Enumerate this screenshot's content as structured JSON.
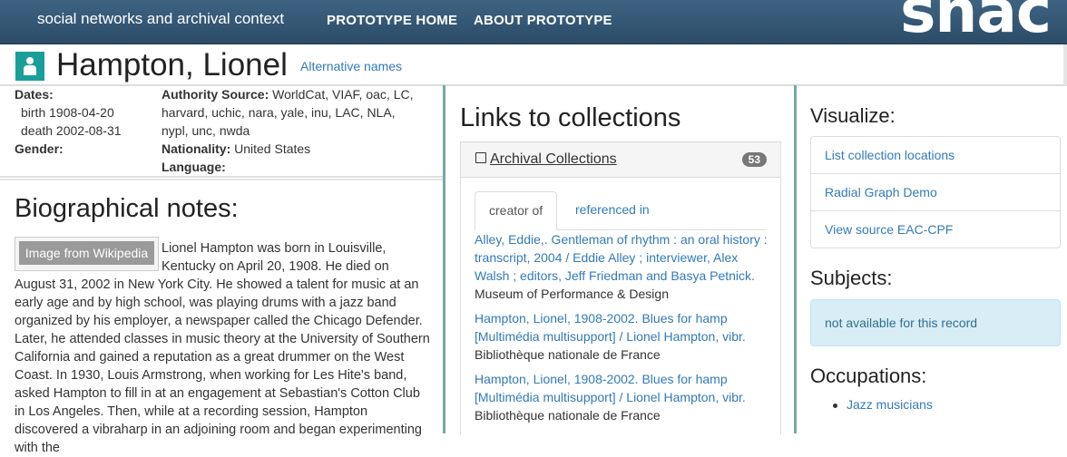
{
  "nav": {
    "brand": "social networks and archival context",
    "links": [
      "PROTOTYPE HOME",
      "ABOUT PROTOTYPE"
    ],
    "logo": "snac"
  },
  "header": {
    "name": "Hampton, Lionel",
    "alt_names_link": "Alternative names"
  },
  "meta": {
    "dates_label": "Dates:",
    "birth": "birth 1908-04-20",
    "death": "death 2002-08-31",
    "gender_label": "Gender:",
    "authority_label": "Authority Source:",
    "authority_line1": "WorldCat, VIAF, oac, LC,",
    "authority_line2": "harvard, uchic, nara, yale, inu, LAC, NLA,",
    "authority_line3": "nypl, unc, nwda",
    "nationality_label": "Nationality:",
    "nationality": "United States",
    "language_label": "Language:"
  },
  "bio": {
    "heading": "Biographical notes:",
    "image_label": "Image from Wikipedia",
    "text": "Lionel Hampton was born in Louisville, Kentucky on April 20, 1908. He died on August 31, 2002 in New York City. He showed a talent for music at an early age and by high school, was playing drums with a jazz band organized by his employer, a newspaper called the Chicago Defender. Later, he attended classes in music theory at the University of Southern California and gained a reputation as a great drummer on the West Coast. In 1930, Louis Armstrong, when working for Les Hite's band, asked Hampton to fill in at an engagement at Sebastian's Cotton Club in Los Angeles. Then, while at a recording session, Hampton discovered a vibraharp in an adjoining room and began experimenting with the"
  },
  "links": {
    "heading": "Links to collections",
    "panel_title": "Archival Collections",
    "count": "53",
    "tabs": [
      "creator of",
      "referenced in"
    ],
    "records": [
      {
        "title": "Alley, Eddie,. Gentleman of rhythm : an oral history : transcript, 2004 / Eddie Alley ; interviewer, Alex Walsh ; editors, Jeff Friedman and Basya Petnick.",
        "repo": "Museum of Performance & Design"
      },
      {
        "title": "Hampton, Lionel, 1908-2002. Blues for hamp [Multimédia multisupport] / Lionel Hampton, vibr.",
        "repo": "Bibliothèque nationale de France"
      },
      {
        "title": "Hampton, Lionel, 1908-2002. Blues for hamp [Multimédia multisupport] / Lionel Hampton, vibr.",
        "repo": "Bibliothèque nationale de France"
      }
    ]
  },
  "visualize": {
    "heading": "Visualize:",
    "items": [
      "List collection locations",
      "Radial Graph Demo",
      "View source EAC-CPF"
    ]
  },
  "subjects": {
    "heading": "Subjects:",
    "message": "not available for this record"
  },
  "occupations": {
    "heading": "Occupations:",
    "items": [
      "Jazz musicians"
    ]
  },
  "colors": {
    "nav_bg": "#34587a",
    "accent_teal": "#1a9e9a",
    "link": "#337ab7",
    "divider": "#74aaa8"
  }
}
